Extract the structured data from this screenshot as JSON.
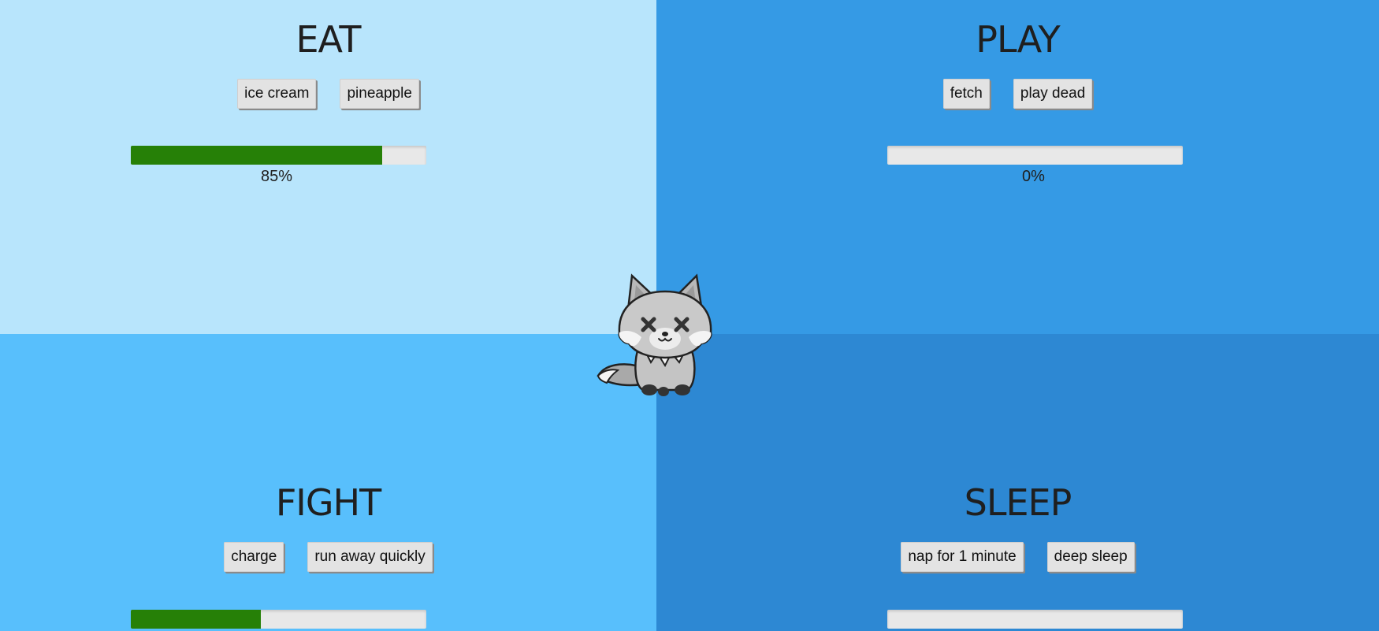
{
  "colors": {
    "eat_bg": "#b8e5fc",
    "play_bg": "#359ae5",
    "fight_bg": "#58bffc",
    "sleep_bg": "#2d88d3",
    "progress_fill": "#268007",
    "progress_track": "#e8e8e8"
  },
  "pet": {
    "icon": "fox-icon",
    "state": "knocked-out"
  },
  "eat": {
    "title": "EAT",
    "buttons": [
      "ice cream",
      "pineapple"
    ],
    "progress": 85,
    "progress_label": "85%"
  },
  "play": {
    "title": "PLAY",
    "buttons": [
      "fetch",
      "play dead"
    ],
    "progress": 0,
    "progress_label": "0%"
  },
  "fight": {
    "title": "FIGHT",
    "buttons": [
      "charge",
      "run away quickly"
    ],
    "progress": 44
  },
  "sleep": {
    "title": "SLEEP",
    "buttons": [
      "nap for 1 minute",
      "deep sleep"
    ],
    "progress": 0
  }
}
